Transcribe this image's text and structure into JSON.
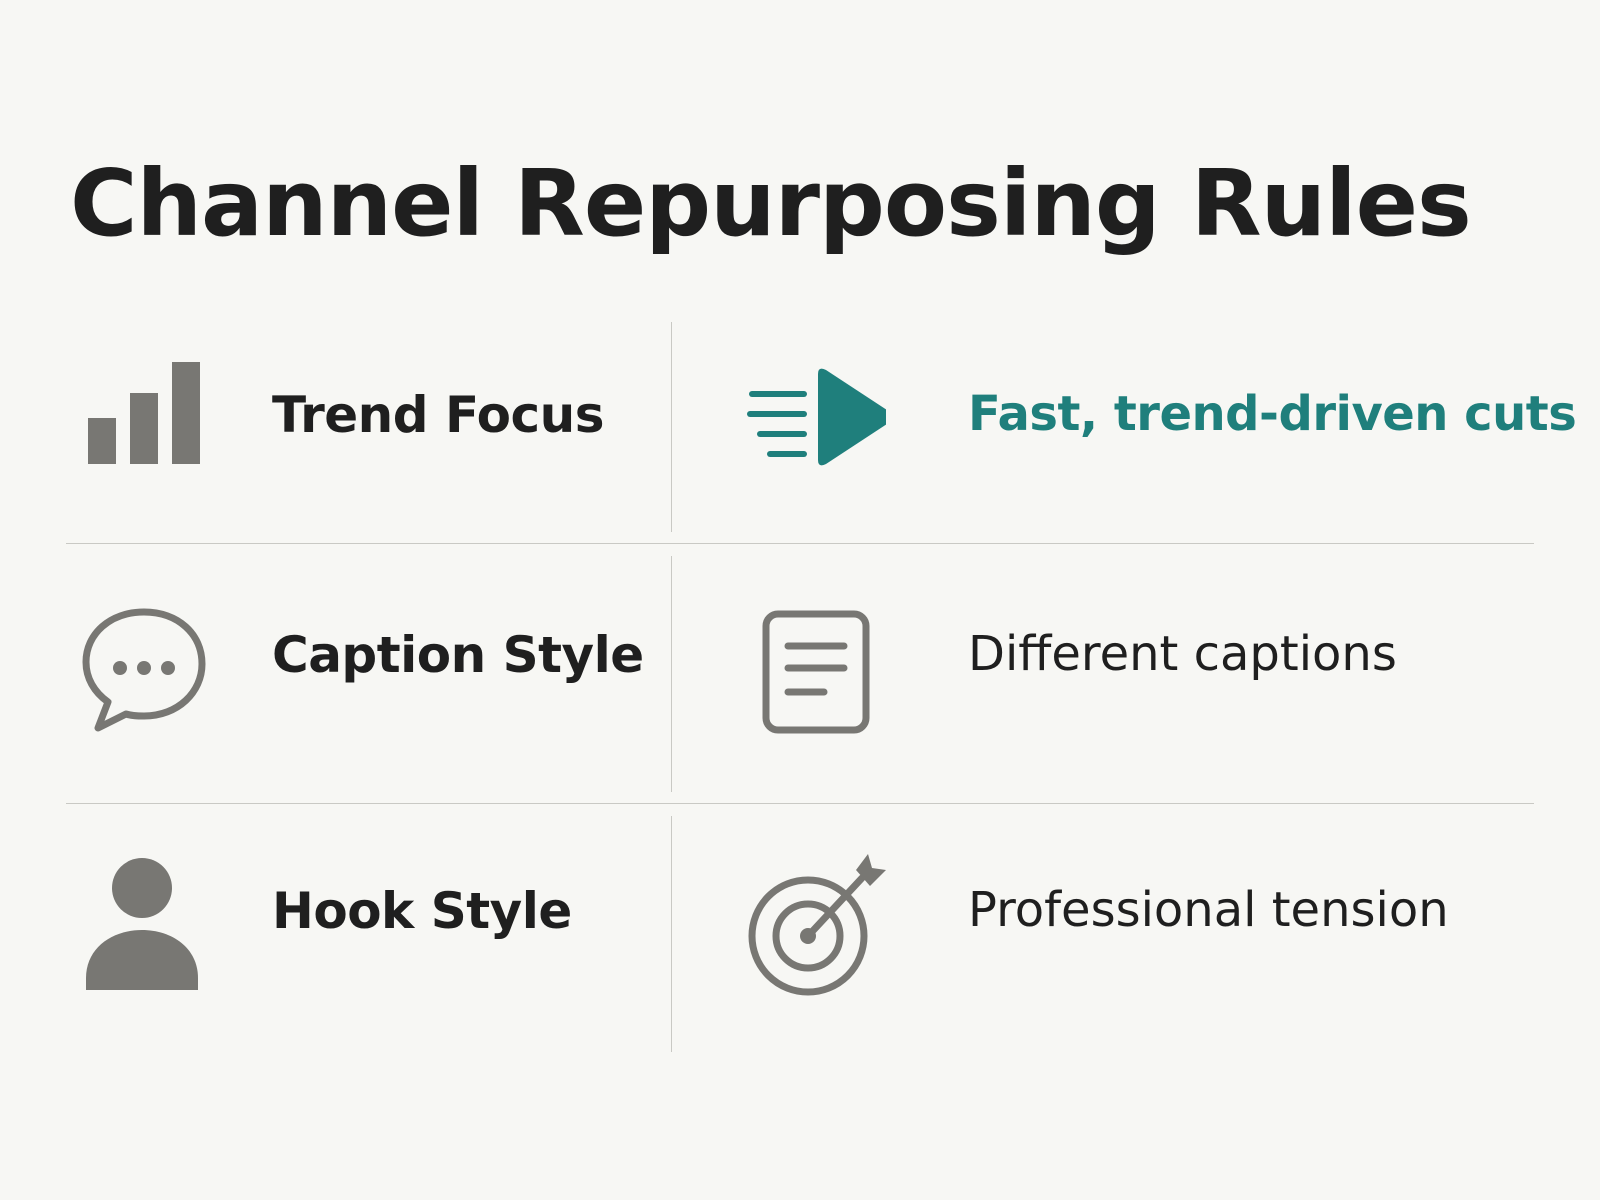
{
  "title": "Channel Repurposing Rules",
  "colors": {
    "accent": "#1f7f7c",
    "icon": "#787773",
    "text": "#1f1f1f",
    "divider": "#c9c9c4",
    "background": "#f7f7f4"
  },
  "rules": [
    {
      "label": "Trend Focus",
      "label_icon": "bar-chart-icon",
      "value": "Fast, trend-driven cuts",
      "value_icon": "fast-play-icon",
      "highlighted": true
    },
    {
      "label": "Caption Style",
      "label_icon": "chat-bubble-icon",
      "value": "Different captions",
      "value_icon": "document-icon",
      "highlighted": false
    },
    {
      "label": "Hook Style",
      "label_icon": "person-icon",
      "value": "Professional tension",
      "value_icon": "target-icon",
      "highlighted": false
    }
  ]
}
